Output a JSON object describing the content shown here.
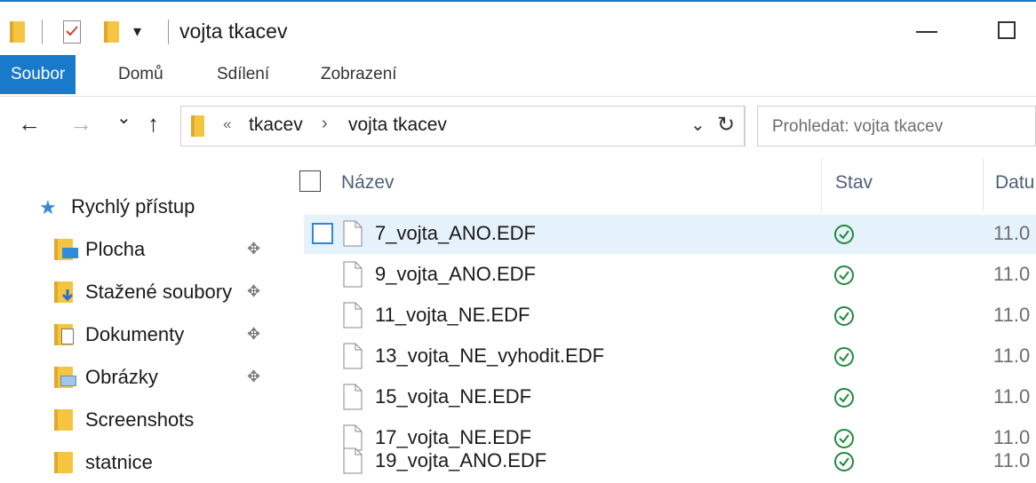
{
  "window": {
    "title": "vojta tkacev",
    "quick_access_dropdown": "▾",
    "minimize_icon": "minimize-icon",
    "maximize_icon": "maximize-icon"
  },
  "ribbon": {
    "tabs": [
      {
        "label": "Soubor",
        "active": true
      },
      {
        "label": "Domů"
      },
      {
        "label": "Sdílení"
      },
      {
        "label": "Zobrazení"
      }
    ]
  },
  "address_bar": {
    "back": "←",
    "forward": "→",
    "recent": "⌄",
    "up": "↑",
    "overflow": "«",
    "crumbs": [
      "tkacev",
      "vojta tkacev"
    ],
    "separator": "›",
    "dropdown": "⌄",
    "refresh": "↻"
  },
  "search": {
    "placeholder": "Prohledat: vojta tkacev"
  },
  "nav_pane": {
    "quick_access_label": "Rychlý přístup",
    "items": [
      {
        "label": "Plocha",
        "pinned": true,
        "icon": "desktop-folder-icon"
      },
      {
        "label": "Stažené soubory",
        "pinned": true,
        "icon": "downloads-folder-icon"
      },
      {
        "label": "Dokumenty",
        "pinned": true,
        "icon": "documents-folder-icon"
      },
      {
        "label": "Obrázky",
        "pinned": true,
        "icon": "pictures-folder-icon"
      },
      {
        "label": "Screenshots",
        "pinned": false,
        "icon": "folder-icon"
      },
      {
        "label": "statnice",
        "pinned": false,
        "icon": "folder-icon"
      }
    ],
    "pin_glyph": "📌"
  },
  "file_list": {
    "columns": {
      "name": "Název",
      "status": "Stav",
      "date": "Datu"
    },
    "rows": [
      {
        "name": "7_vojta_ANO.EDF",
        "date": "11.0",
        "selected": true
      },
      {
        "name": "9_vojta_ANO.EDF",
        "date": "11.0"
      },
      {
        "name": "11_vojta_NE.EDF",
        "date": "11.0"
      },
      {
        "name": "13_vojta_NE_vyhodit.EDF",
        "date": "11.0"
      },
      {
        "name": "15_vojta_NE.EDF",
        "date": "11.0"
      },
      {
        "name": "17_vojta_NE.EDF",
        "date": "11.0"
      },
      {
        "name": "19_vojta_ANO.EDF",
        "date": "11.0"
      }
    ]
  },
  "colors": {
    "accent": "#1979ca",
    "selection": "#e5f1fb",
    "status_green": "#1e8a3c",
    "folder": "#f5c542"
  }
}
